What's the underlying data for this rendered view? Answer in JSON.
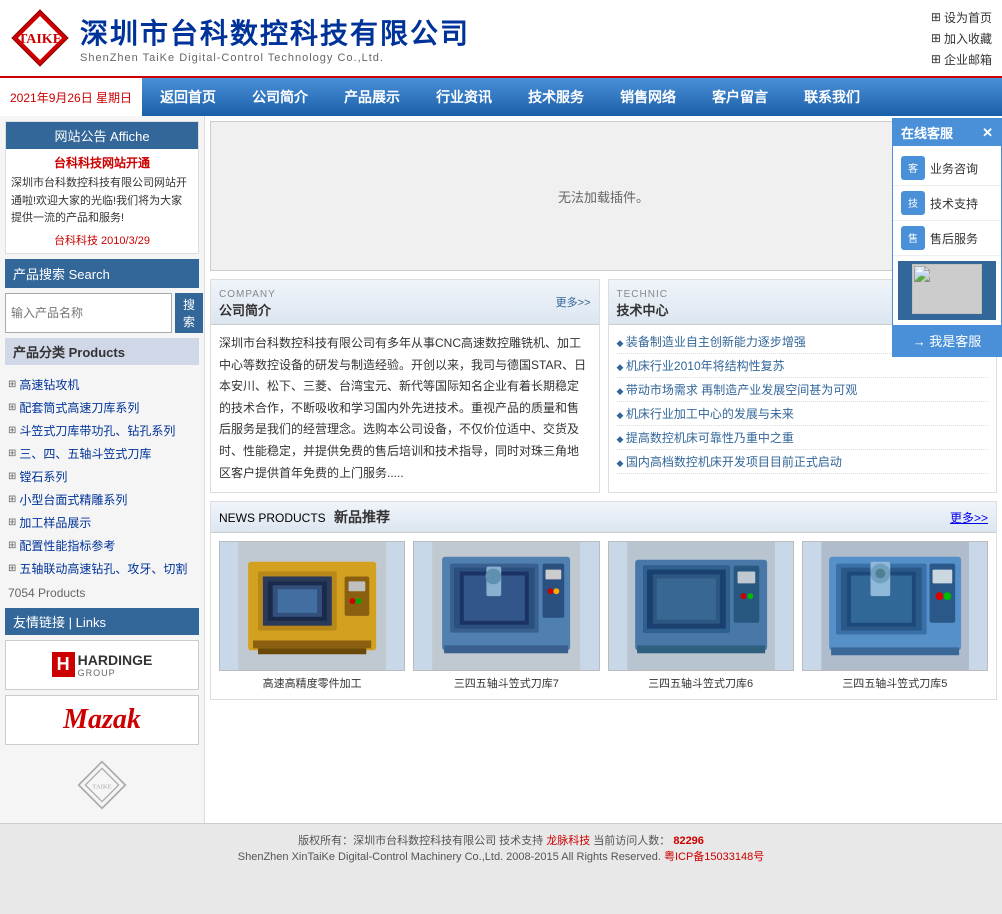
{
  "header": {
    "company_name_cn": "深圳市台科数控科技有限公司",
    "company_name_en": "ShenZhen TaiKe Digital-Control Technology Co.,Ltd.",
    "top_links": [
      {
        "label": "设为首页",
        "icon": "home-icon"
      },
      {
        "label": "加入收藏",
        "icon": "star-icon"
      },
      {
        "label": "企业邮箱",
        "icon": "mail-icon"
      }
    ]
  },
  "nav": {
    "date": "2021年9月26日  星期日",
    "items": [
      {
        "label": "返回首页"
      },
      {
        "label": "公司简介"
      },
      {
        "label": "产品展示"
      },
      {
        "label": "行业资讯"
      },
      {
        "label": "技术服务"
      },
      {
        "label": "销售网络"
      },
      {
        "label": "客户留言"
      },
      {
        "label": "联系我们"
      }
    ]
  },
  "sidebar": {
    "announce": {
      "title": "网站公告 Affiche",
      "link_text": "台科科技网站开通",
      "content": "深圳市台科数控科技有限公司网站开通啦!欢迎大家的光临!我们将为大家提供一流的产品和服务!",
      "date": "台科科技 2010/3/29"
    },
    "search": {
      "title": "产品搜索 Search",
      "placeholder": "输入产品名称",
      "button_label": "搜索"
    },
    "cat_title": "产品分类 Products",
    "categories": [
      {
        "label": "高速钻攻机"
      },
      {
        "label": "配套筒式高速刀库系列"
      },
      {
        "label": "斗笠式刀库带功孔、钻孔系列"
      },
      {
        "label": "三、四、五轴斗笠式刀库"
      },
      {
        "label": "镗石系列"
      },
      {
        "label": "小型台面式精雕系列"
      },
      {
        "label": "加工样品展示"
      },
      {
        "label": "配置性能指标参考"
      },
      {
        "label": "五轴联动高速钻孔、攻牙、切割"
      }
    ],
    "products_count": "7054 Products",
    "links_title": "友情链接 | Links",
    "partners": [
      {
        "name": "Hardinge Group"
      },
      {
        "name": "Mazak"
      }
    ]
  },
  "flash": {
    "message": "无法加载插件。"
  },
  "company_section": {
    "title_cn": "公司简介",
    "title_en": "COMPANY",
    "more_label": "更多>>",
    "content": "深圳市台科数控科技有限公司有多年从事CNC高速数控雕铣机、加工中心等数控设备的研发与制造经验。开创以来，我司与德国STAR、日本安川、松下、三菱、台湾宝元、新代等国际知名企业有着长期稳定的技术合作，不断吸收和学习国内外先进技术。重视产品的质量和售后服务是我们的经营理念。选购本公司设备，不仅价位适中、交货及时、性能稳定，并提供免费的售后培训和技术指导，同时对珠三角地区客户提供首年免费的上门服务....."
  },
  "tech_section": {
    "title_cn": "技术中心",
    "title_en": "TECHNIC",
    "more_label": "更多>>",
    "items": [
      {
        "label": "装备制造业自主创新能力逐步增强"
      },
      {
        "label": "机床行业2010年将结构性复苏"
      },
      {
        "label": "带动市场需求 再制造产业发展空间甚为可观"
      },
      {
        "label": "机床行业加工中心的发展与未来"
      },
      {
        "label": "提高数控机床可靠性乃重中之重"
      },
      {
        "label": "国内高档数控机床开发项目目前正式启动"
      }
    ]
  },
  "news_section": {
    "title_cn": "新品推荐",
    "title_en": "NEWS PRODUCTS",
    "more_label": "更多>>",
    "products": [
      {
        "name": "高速高精度零件加工"
      },
      {
        "name": "三四五轴斗笠式刀库7"
      },
      {
        "name": "三四五轴斗笠式刀库6"
      },
      {
        "name": "三四五轴斗笠式刀库5"
      }
    ]
  },
  "online_service": {
    "title": "在线客服",
    "items": [
      {
        "label": "业务咨询"
      },
      {
        "label": "技术支持"
      },
      {
        "label": "售后服务"
      }
    ],
    "button_label": "→ 我是客服"
  },
  "footer": {
    "copyright": "版权所有：深圳市台科数控科技有限公司  技术支持",
    "link_text": "龙脉科技",
    "visitors": "当前访问人数：",
    "visitor_count": "82296",
    "company_en": "ShenZhen XinTaiKe Digital-Control Machinery Co.,Ltd.  2008-2015  All Rights Reserved.",
    "icp": "粤ICP备15033148号"
  }
}
